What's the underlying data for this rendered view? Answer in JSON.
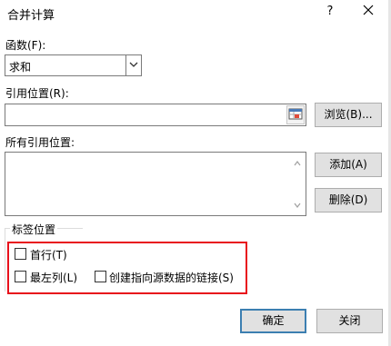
{
  "dialog": {
    "title": "合并计算",
    "help": "?",
    "close": "✕"
  },
  "function": {
    "label": "函数(F):",
    "selected": "求和"
  },
  "reference": {
    "label": "引用位置(R):",
    "value": "",
    "browse_label": "浏览(B)..."
  },
  "all_references": {
    "label": "所有引用位置:",
    "items": [],
    "add_label": "添加(A)",
    "delete_label": "删除(D)"
  },
  "labels": {
    "group_title": "标签位置",
    "first_row": "首行(T)",
    "left_column": "最左列(L)",
    "create_links": "创建指向源数据的链接(S)",
    "first_row_checked": false,
    "left_column_checked": false,
    "create_links_checked": false
  },
  "footer": {
    "ok_label": "确定",
    "close_label": "关闭"
  },
  "colors": {
    "highlight": "#e8101b",
    "default_button_border": "#3c7fb1"
  }
}
